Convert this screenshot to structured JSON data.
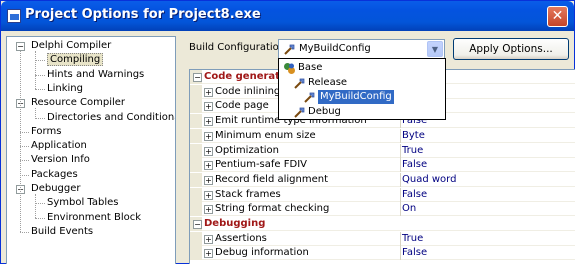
{
  "window": {
    "title": "Project Options for Project8.exe",
    "close_label": "✕"
  },
  "tree": [
    {
      "label": "Delphi Compiler",
      "level": 0,
      "expanded": true
    },
    {
      "label": "Compiling",
      "level": 1,
      "selected": true
    },
    {
      "label": "Hints and Warnings",
      "level": 1
    },
    {
      "label": "Linking",
      "level": 1
    },
    {
      "label": "Resource Compiler",
      "level": 0,
      "expanded": true
    },
    {
      "label": "Directories and Conditionals",
      "level": 1
    },
    {
      "label": "Forms",
      "level": 0
    },
    {
      "label": "Application",
      "level": 0
    },
    {
      "label": "Version Info",
      "level": 0
    },
    {
      "label": "Packages",
      "level": 0
    },
    {
      "label": "Debugger",
      "level": 0,
      "expanded": true
    },
    {
      "label": "Symbol Tables",
      "level": 1
    },
    {
      "label": "Environment Block",
      "level": 1
    },
    {
      "label": "Build Events",
      "level": 0
    }
  ],
  "build_config": {
    "label": "Build Configuration",
    "value": "MyBuildConfig",
    "apply_label": "Apply Options..."
  },
  "dropdown": [
    {
      "label": "Base",
      "icon": "base-config-icon"
    },
    {
      "label": "Release",
      "icon": "build-config-icon"
    },
    {
      "label": "MyBuildConfig",
      "icon": "build-config-icon",
      "highlighted": true
    },
    {
      "label": "Debug",
      "icon": "build-config-icon"
    }
  ],
  "grid": [
    {
      "type": "category",
      "name": "Code generation"
    },
    {
      "name": "Code inlining control",
      "value": ""
    },
    {
      "name": "Code page",
      "value": ""
    },
    {
      "name": "Emit runtime type information",
      "value": "False"
    },
    {
      "name": "Minimum enum size",
      "value": "Byte"
    },
    {
      "name": "Optimization",
      "value": "True"
    },
    {
      "name": "Pentium-safe FDIV",
      "value": "False"
    },
    {
      "name": "Record field alignment",
      "value": "Quad word"
    },
    {
      "name": "Stack frames",
      "value": "False"
    },
    {
      "name": "String format checking",
      "value": "On"
    },
    {
      "type": "category",
      "name": "Debugging"
    },
    {
      "name": "Assertions",
      "value": "True"
    },
    {
      "name": "Debug information",
      "value": "False"
    }
  ],
  "colors": {
    "title_bar": "#0453e0",
    "highlight": "#316ac5",
    "category": "#a01818",
    "value": "#000080"
  }
}
